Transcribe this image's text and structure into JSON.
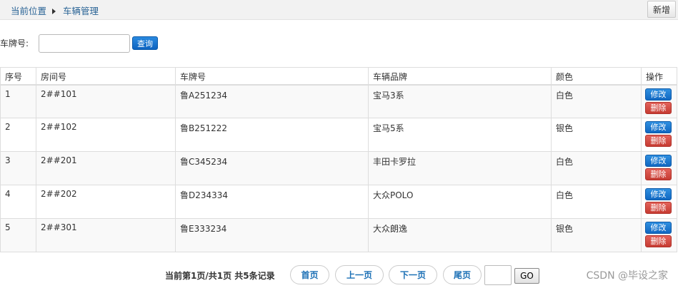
{
  "breadcrumb": {
    "current_label": "当前位置",
    "page": "车辆管理"
  },
  "toolbar": {
    "add_label": "新增"
  },
  "search": {
    "label": "车牌号:",
    "value": "",
    "placeholder": "",
    "button_label": "查询"
  },
  "table": {
    "columns": [
      "序号",
      "房间号",
      "车牌号",
      "车辆品牌",
      "颜色",
      "操作"
    ],
    "rows": [
      {
        "index": "1",
        "room": "2##101",
        "plate": "鲁A251234",
        "brand": "宝马3系",
        "color": "白色"
      },
      {
        "index": "2",
        "room": "2##102",
        "plate": "鲁B251222",
        "brand": "宝马5系",
        "color": "银色"
      },
      {
        "index": "3",
        "room": "2##201",
        "plate": "鲁C345234",
        "brand": "丰田卡罗拉",
        "color": "白色"
      },
      {
        "index": "4",
        "room": "2##202",
        "plate": "鲁D234334",
        "brand": "大众POLO",
        "color": "白色"
      },
      {
        "index": "5",
        "room": "2##301",
        "plate": "鲁E333234",
        "brand": "大众朗逸",
        "color": "银色"
      }
    ],
    "edit_label": "修改",
    "delete_label": "删除"
  },
  "pager": {
    "info": "当前第1页/共1页  共5条记录",
    "first": "首页",
    "prev": "上一页",
    "next": "下一页",
    "last": "尾页",
    "page_value": "",
    "go": "GO"
  },
  "watermark": "CSDN @毕设之家",
  "colors": {
    "primary": "#1168c2",
    "danger": "#c63b32",
    "link": "#2a6496"
  }
}
